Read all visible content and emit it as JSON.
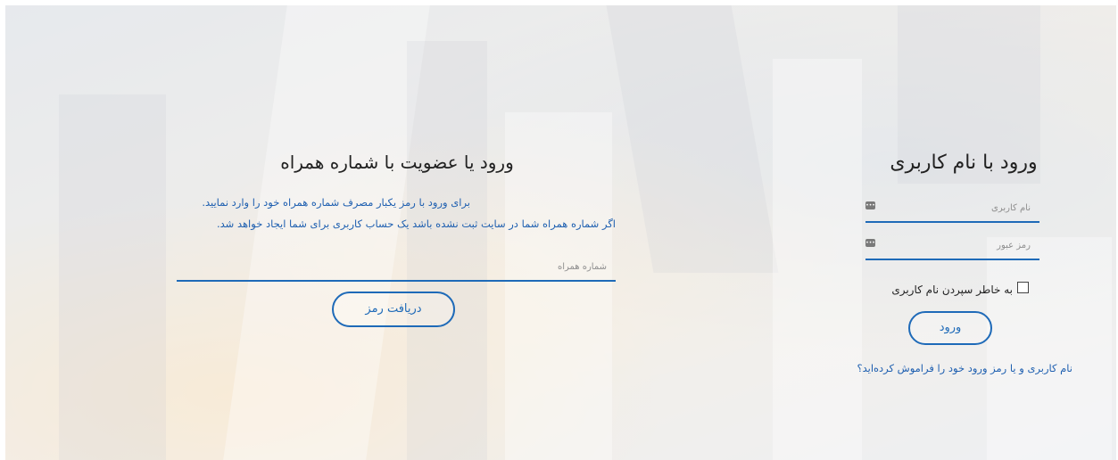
{
  "username_login": {
    "title": "ورود با نام کاربری",
    "username_placeholder": "نام کاربری",
    "password_placeholder": "رمز عبور",
    "remember_label": "به خاطر سپردن نام کاربری",
    "login_button": "ورود",
    "forgot_link": "نام کاربری و یا رمز ورود خود را فراموش کرده‌اید؟"
  },
  "mobile_login": {
    "title": "ورود یا عضویت با شماره همراه",
    "info_line_1": "برای ورود با رمز یکبار مصرف شماره همراه خود را وارد نمایید.",
    "info_line_2": "اگر شماره همراه شما در سایت ثبت نشده باشد یک حساب کاربری برای شما ایجاد خواهد شد.",
    "mobile_placeholder": "شماره همراه",
    "get_code_button": "دریافت رمز"
  },
  "colors": {
    "accent": "#1e6ab8",
    "link": "#1e5fb0",
    "title": "#222222"
  }
}
